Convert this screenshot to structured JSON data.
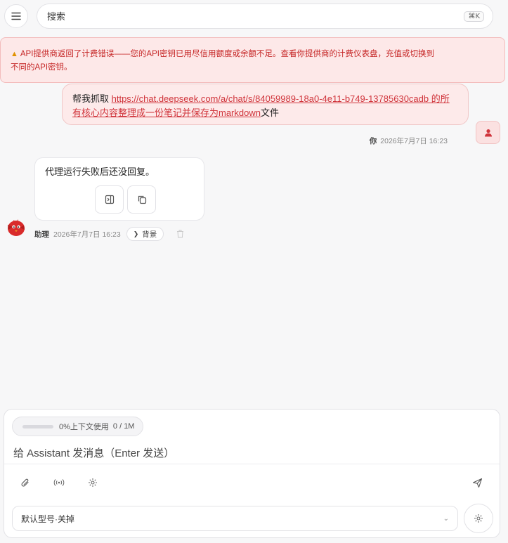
{
  "search": {
    "placeholder": "搜索",
    "shortcut": "⌘K"
  },
  "error": {
    "line1": "API提供商返回了计费错误——您的API密钥已用尽信用额度或余额不足。查看你提供商的计费仪表盘，充值或切换到",
    "line2": "不同的API密钥。"
  },
  "user_message": {
    "prefix": "帮我抓取 ",
    "link": "https://chat.deepseek.com/a/chat/s/84059989-18a0-4e11-b749-13785630cadb 的所有核心内容整理成一份笔记并保存为markdown",
    "suffix": "文件",
    "author": "你",
    "time": "2026年7月7日 16:23"
  },
  "assistant_message": {
    "text": "代理运行失败后还没回复。",
    "author": "助理",
    "time": "2026年7月7日 16:23",
    "background_label": "背景"
  },
  "composer": {
    "context_percent": "0%上下文使用",
    "context_tokens": "0 / 1M",
    "placeholder": "给 Assistant 发消息（Enter 发送）",
    "model_label": "默认型号·关掉"
  },
  "colors": {
    "accent": "#d0343b",
    "error_bg": "#fde8e8",
    "user_bubble": "#fdeaea"
  }
}
